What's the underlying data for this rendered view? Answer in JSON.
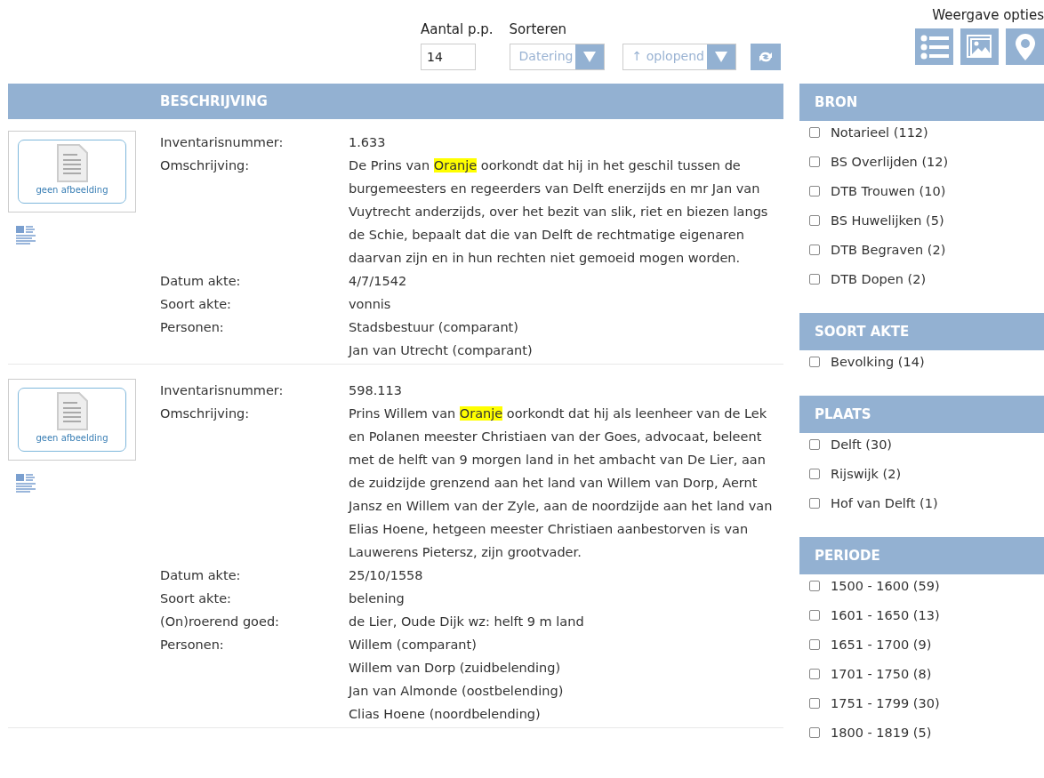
{
  "controls": {
    "per_page": {
      "label": "Aantal p.p.",
      "value": "14"
    },
    "sort": {
      "label": "Sorteren",
      "field": "Datering",
      "order": "↑ oplopend"
    },
    "view_options": {
      "label": "Weergave opties"
    }
  },
  "results": {
    "column": "BESCHRIJVING",
    "records": [
      {
        "thumbnail": "geen afbeelding",
        "fields": [
          {
            "kind": "plain",
            "label": "Inventarisnummer:",
            "values": [
              "1.633"
            ]
          },
          {
            "kind": "description",
            "label": "Omschrijving:",
            "segments": [
              {
                "text": "De Prins van ",
                "highlighted": false
              },
              {
                "text": "Oranje",
                "highlighted": true
              },
              {
                "text": " oorkondt dat hij in het geschil tussen de burgemeesters en regeerders van Delft enerzijds en mr Jan van Vuytrecht anderzijds, over het bezit van slik, riet en biezen langs de Schie, bepaalt dat die van Delft de rechtmatige eigenaren daarvan zijn en in hun rechten niet gemoeid mogen worden.",
                "highlighted": false
              }
            ]
          },
          {
            "kind": "plain",
            "label": "Datum akte:",
            "values": [
              "4/7/1542"
            ]
          },
          {
            "kind": "plain",
            "label": "Soort akte:",
            "values": [
              "vonnis"
            ]
          },
          {
            "kind": "plain",
            "label": "Personen:",
            "values": [
              "Stadsbestuur (comparant)",
              "Jan van Utrecht (comparant)"
            ]
          }
        ]
      },
      {
        "thumbnail": "geen afbeelding",
        "fields": [
          {
            "kind": "plain",
            "label": "Inventarisnummer:",
            "values": [
              "598.113"
            ]
          },
          {
            "kind": "description",
            "label": "Omschrijving:",
            "segments": [
              {
                "text": "Prins Willem van ",
                "highlighted": false
              },
              {
                "text": "Oranje",
                "highlighted": true
              },
              {
                "text": " oorkondt dat hij als leenheer van de Lek en Polanen meester Christiaen van der Goes, advocaat, beleent met de helft van 9 morgen land in het ambacht van De Lier, aan de zuidzijde grenzend aan het land van Willem van Dorp, Aernt Jansz en Willem van der Zyle, aan de noordzijde aan het land van Elias Hoene, hetgeen meester Christiaen aanbestorven is van Lauwerens Pietersz, zijn grootvader.",
                "highlighted": false
              }
            ]
          },
          {
            "kind": "plain",
            "label": "Datum akte:",
            "values": [
              "25/10/1558"
            ]
          },
          {
            "kind": "plain",
            "label": "Soort akte:",
            "values": [
              "belening"
            ]
          },
          {
            "kind": "plain",
            "label": "(On)roerend goed:",
            "values": [
              "de Lier, Oude Dijk wz: helft 9 m land"
            ]
          },
          {
            "kind": "plain",
            "label": "Personen:",
            "values": [
              "Willem (comparant)",
              "Willem van Dorp (zuidbelending)",
              "Jan van Almonde (oostbelending)",
              "Clias Hoene (noordbelending)"
            ]
          }
        ]
      }
    ]
  },
  "filters": [
    {
      "title": "BRON",
      "items": [
        {
          "label": "Notarieel (112)",
          "checked": false
        },
        {
          "label": "BS Overlijden (12)",
          "checked": false
        },
        {
          "label": "DTB Trouwen (10)",
          "checked": false
        },
        {
          "label": "BS Huwelijken (5)",
          "checked": false
        },
        {
          "label": "DTB Begraven (2)",
          "checked": false
        },
        {
          "label": "DTB Dopen (2)",
          "checked": false
        }
      ]
    },
    {
      "title": "SOORT AKTE",
      "items": [
        {
          "label": "Bevolking (14)",
          "checked": false
        }
      ]
    },
    {
      "title": "PLAATS",
      "items": [
        {
          "label": "Delft (30)",
          "checked": false
        },
        {
          "label": "Rijswijk (2)",
          "checked": false
        },
        {
          "label": "Hof van Delft (1)",
          "checked": false
        }
      ]
    },
    {
      "title": "PERIODE",
      "items": [
        {
          "label": "1500 - 1600 (59)",
          "checked": false
        },
        {
          "label": "1601 - 1650 (13)",
          "checked": false
        },
        {
          "label": "1651 - 1700 (9)",
          "checked": false
        },
        {
          "label": "1701 - 1750 (8)",
          "checked": false
        },
        {
          "label": "1751 - 1799 (30)",
          "checked": false
        },
        {
          "label": "1800 - 1819 (5)",
          "checked": false
        }
      ]
    }
  ]
}
